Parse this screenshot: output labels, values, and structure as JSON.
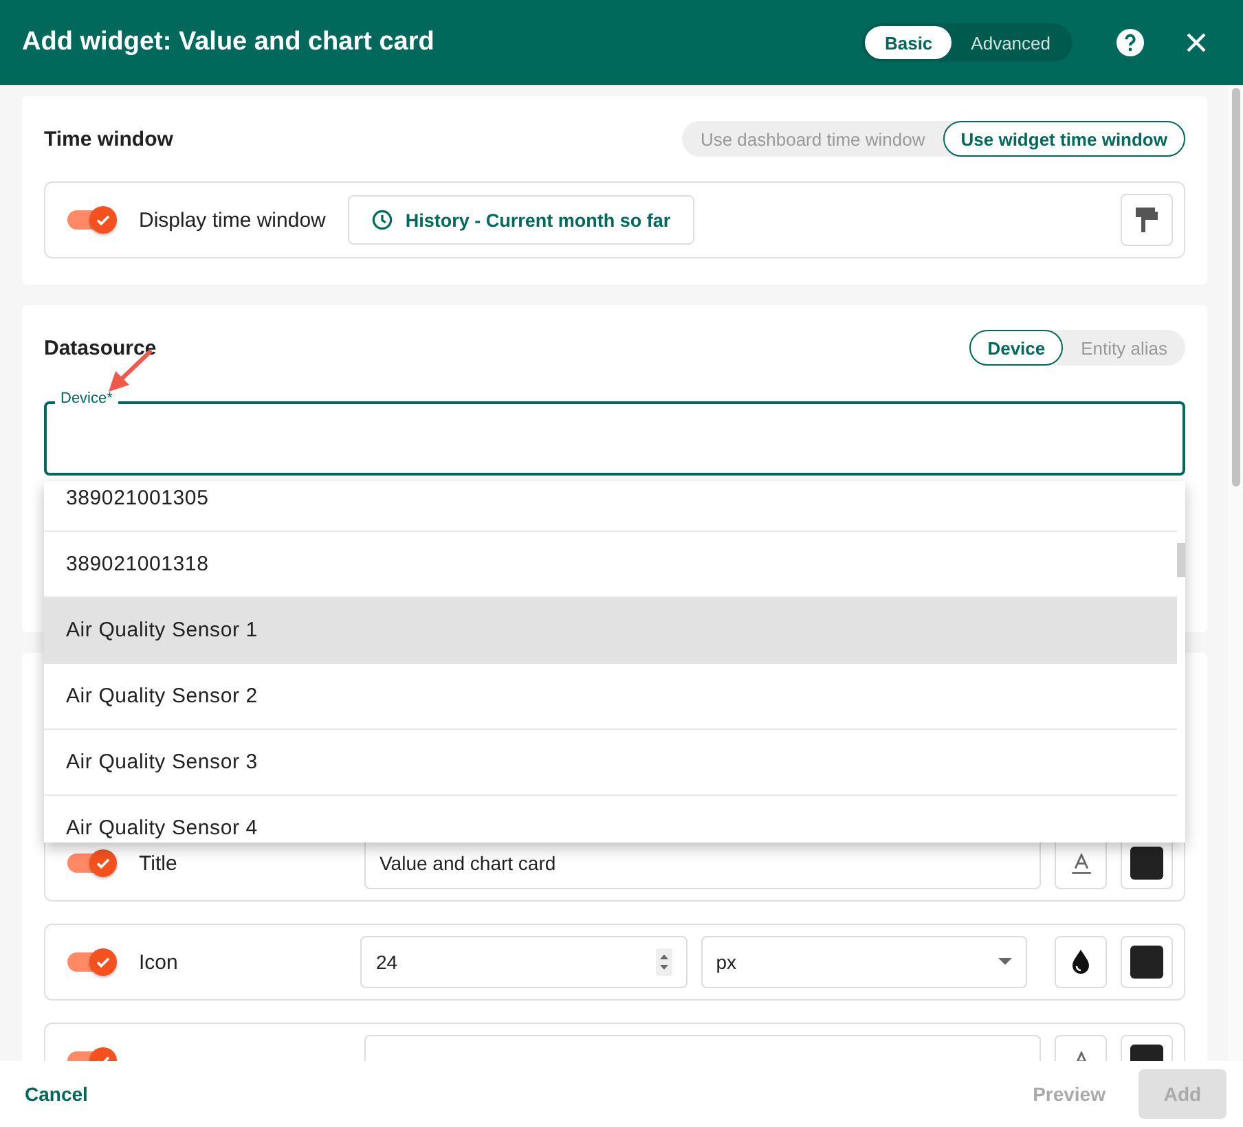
{
  "dialog": {
    "title": "Add widget: Value and chart card",
    "modes": [
      {
        "label": "Basic",
        "selected": true
      },
      {
        "label": "Advanced",
        "selected": false
      }
    ]
  },
  "time_window": {
    "title": "Time window",
    "options": [
      {
        "label": "Use dashboard time window",
        "selected": false
      },
      {
        "label": "Use widget time window",
        "selected": true
      }
    ],
    "display_toggle": {
      "label": "Display time window",
      "on": true
    },
    "timewindow_button": "History - Current month so far"
  },
  "datasource": {
    "title": "Datasource",
    "options": [
      {
        "label": "Device",
        "selected": true
      },
      {
        "label": "Entity alias",
        "selected": false
      }
    ],
    "device_field": {
      "label": "Device*"
    }
  },
  "dropdown": {
    "items": [
      {
        "label": "389021001305",
        "highlighted": false
      },
      {
        "label": "389021001318",
        "highlighted": false
      },
      {
        "label": "Air Quality Sensor 1",
        "highlighted": true
      },
      {
        "label": "Air Quality Sensor 2",
        "highlighted": false
      },
      {
        "label": "Air Quality Sensor 3",
        "highlighted": false
      },
      {
        "label": "Air Quality Sensor 4",
        "highlighted": false
      }
    ]
  },
  "appearance_rows": [
    {
      "kind": "text",
      "label": "Title",
      "on": true,
      "value": "Value and chart card"
    },
    {
      "kind": "size",
      "label": "Icon",
      "on": true,
      "value": "24",
      "unit": "px"
    },
    {
      "kind": "text",
      "on": true
    }
  ],
  "footer": {
    "cancel": "Cancel",
    "preview": "Preview",
    "add": {
      "label": "Add",
      "disabled": true
    }
  }
}
